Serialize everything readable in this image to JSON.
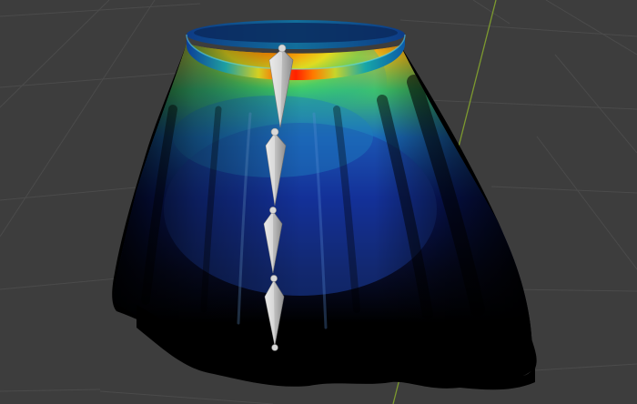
{
  "viewport": {
    "background_color": "#3d3d3d",
    "grid_line_color": "#4b4b4b",
    "y_axis_color": "#7d9a2f"
  },
  "mesh": {
    "object": "skirt",
    "display_mode": "weight-paint",
    "shadow_color": "#000000",
    "weight_colors": {
      "zero": "#0b1f86",
      "low": "#1b5cc8",
      "mid_low": "#16b6b0",
      "mid": "#5fd43a",
      "mid_high": "#e7e21e",
      "high": "#ff7a00",
      "full": "#ff2000"
    }
  },
  "armature": {
    "display": "octahedral",
    "bone_color": "#c9c9c9",
    "joint_color": "#d8d8d8",
    "bone_count": 4
  }
}
